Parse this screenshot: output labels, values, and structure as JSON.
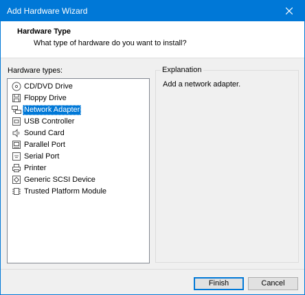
{
  "window": {
    "title": "Add Hardware Wizard"
  },
  "header": {
    "title": "Hardware Type",
    "subtitle": "What type of hardware do you want to install?"
  },
  "hardware_types": {
    "label": "Hardware types:",
    "selected": "Network Adapter",
    "items": [
      {
        "label": "CD/DVD Drive",
        "icon": "cd-dvd-icon"
      },
      {
        "label": "Floppy Drive",
        "icon": "floppy-icon"
      },
      {
        "label": "Network Adapter",
        "icon": "network-adapter-icon"
      },
      {
        "label": "USB Controller",
        "icon": "usb-icon"
      },
      {
        "label": "Sound Card",
        "icon": "speaker-icon"
      },
      {
        "label": "Parallel Port",
        "icon": "parallel-port-icon"
      },
      {
        "label": "Serial Port",
        "icon": "serial-port-icon"
      },
      {
        "label": "Printer",
        "icon": "printer-icon"
      },
      {
        "label": "Generic SCSI Device",
        "icon": "scsi-icon"
      },
      {
        "label": "Trusted Platform Module",
        "icon": "tpm-icon"
      }
    ]
  },
  "explanation": {
    "label": "Explanation",
    "text": "Add a network adapter."
  },
  "buttons": {
    "finish": "Finish",
    "cancel": "Cancel"
  },
  "colors": {
    "accent": "#0078d7",
    "face": "#f0f0f0"
  }
}
